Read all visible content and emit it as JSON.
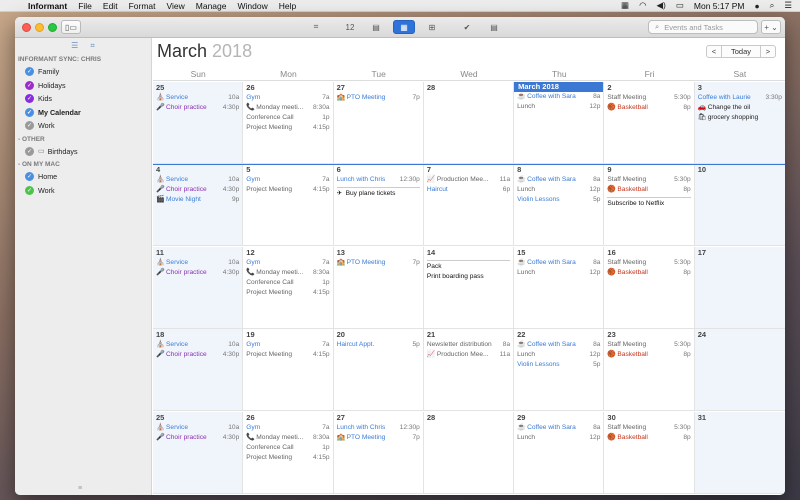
{
  "menubar": {
    "app_name": "Informant",
    "menus": [
      "File",
      "Edit",
      "Format",
      "View",
      "Manage",
      "Window",
      "Help"
    ],
    "clock": "Mon 5:17 PM"
  },
  "toolbar": {
    "day_badge": "12",
    "search_placeholder": "Events and Tasks",
    "add_label": "+ ⌄"
  },
  "sidebar": {
    "sections": [
      {
        "title": "INFORMANT SYNC: CHRIS",
        "items": [
          {
            "label": "Family",
            "color": "#4a90e2",
            "bold": false
          },
          {
            "label": "Holidays",
            "color": "#9b30c8",
            "bold": false
          },
          {
            "label": "Kids",
            "color": "#8a2be2",
            "bold": false
          },
          {
            "label": "My Calendar",
            "color": "#4a90e2",
            "bold": true
          },
          {
            "label": "Work",
            "color": "#9a9a9a",
            "bold": false
          }
        ]
      },
      {
        "title": "- OTHER",
        "items": [
          {
            "label": "Birthdays",
            "color": "#9a9a9a",
            "bold": false
          }
        ]
      },
      {
        "title": "- ON MY MAC",
        "items": [
          {
            "label": "Home",
            "color": "#4a90e2",
            "bold": false
          },
          {
            "label": "Work",
            "color": "#4cc44c",
            "bold": false
          }
        ]
      }
    ]
  },
  "calendar": {
    "month": "March",
    "year": "2018",
    "today_btn": "Today",
    "prev_btn": "<",
    "next_btn": ">",
    "weekdays": [
      "Sun",
      "Mon",
      "Tue",
      "Wed",
      "Thu",
      "Fri",
      "Sat"
    ],
    "weeks": [
      [
        {
          "day": "25",
          "events": [
            {
              "icon": "⛪",
              "title": "Service",
              "time": "10a",
              "color": "blue"
            },
            {
              "icon": "🎤",
              "title": "Choir practice",
              "time": "4:30p",
              "color": "purple"
            }
          ]
        },
        {
          "day": "26",
          "events": [
            {
              "icon": "",
              "title": "Gym",
              "time": "7a",
              "color": "blue"
            },
            {
              "icon": "📞",
              "title": "Monday meeti...",
              "time": "8:30a",
              "color": "gray"
            },
            {
              "icon": "",
              "title": "Conference Call",
              "time": "1p",
              "color": "gray"
            },
            {
              "icon": "",
              "title": "Project Meeting",
              "time": "4:15p",
              "color": "gray"
            }
          ]
        },
        {
          "day": "27",
          "events": [
            {
              "icon": "🏫",
              "title": "PTO Meeting",
              "time": "7p",
              "color": "blue"
            }
          ]
        },
        {
          "day": "28",
          "events": []
        },
        {
          "day": "March 2018",
          "today": true,
          "events": [
            {
              "icon": "☕",
              "title": "Coffee with Sara",
              "time": "8a",
              "color": "blue"
            },
            {
              "icon": "",
              "title": "Lunch",
              "time": "12p",
              "color": "gray"
            }
          ]
        },
        {
          "day": "2",
          "events": [
            {
              "icon": "",
              "title": "Staff Meeting",
              "time": "5:30p",
              "color": "gray"
            },
            {
              "icon": "🏀",
              "title": "Basketball",
              "time": "8p",
              "color": "red"
            }
          ]
        },
        {
          "day": "3",
          "events": [
            {
              "icon": "",
              "title": "Coffee with Laurie",
              "time": "3:30p",
              "color": "blue"
            },
            {
              "icon": "🚗",
              "title": "Change the oil",
              "time": "",
              "color": "black"
            },
            {
              "icon": "🛍",
              "title": "grocery shopping",
              "time": "",
              "color": "black"
            }
          ]
        }
      ],
      [
        {
          "day": "4",
          "events": [
            {
              "icon": "⛪",
              "title": "Service",
              "time": "10a",
              "color": "blue"
            },
            {
              "icon": "🎤",
              "title": "Choir practice",
              "time": "4:30p",
              "color": "purple"
            },
            {
              "icon": "🎬",
              "title": "Movie Night",
              "time": "9p",
              "color": "blue"
            }
          ]
        },
        {
          "day": "5",
          "events": [
            {
              "icon": "",
              "title": "Gym",
              "time": "7a",
              "color": "blue"
            },
            {
              "icon": "",
              "title": "Project Meeting",
              "time": "4:15p",
              "color": "gray"
            }
          ]
        },
        {
          "day": "6",
          "events": [
            {
              "icon": "",
              "title": "Lunch with Chris",
              "time": "12:30p",
              "color": "blue"
            }
          ],
          "tasks": [
            {
              "icon": "✈",
              "title": "Buy plane tickets"
            }
          ]
        },
        {
          "day": "7",
          "events": [
            {
              "icon": "📈",
              "title": "Production Mee...",
              "time": "11a",
              "color": "gray"
            },
            {
              "icon": "",
              "title": "Haircut",
              "time": "6p",
              "color": "blue"
            }
          ]
        },
        {
          "day": "8",
          "events": [
            {
              "icon": "☕",
              "title": "Coffee with Sara",
              "time": "8a",
              "color": "blue"
            },
            {
              "icon": "",
              "title": "Lunch",
              "time": "12p",
              "color": "gray"
            },
            {
              "icon": "",
              "title": "Violin Lessons",
              "time": "5p",
              "color": "blue"
            }
          ]
        },
        {
          "day": "9",
          "events": [
            {
              "icon": "",
              "title": "Staff Meeting",
              "time": "5:30p",
              "color": "gray"
            },
            {
              "icon": "🏀",
              "title": "Basketball",
              "time": "8p",
              "color": "red"
            }
          ],
          "tasks": [
            {
              "icon": "",
              "title": "Subscribe to Netflix"
            }
          ]
        },
        {
          "day": "10",
          "events": []
        }
      ],
      [
        {
          "day": "11",
          "events": [
            {
              "icon": "⛪",
              "title": "Service",
              "time": "10a",
              "color": "blue"
            },
            {
              "icon": "🎤",
              "title": "Choir practice",
              "time": "4:30p",
              "color": "purple"
            }
          ]
        },
        {
          "day": "12",
          "events": [
            {
              "icon": "",
              "title": "Gym",
              "time": "7a",
              "color": "blue"
            },
            {
              "icon": "📞",
              "title": "Monday meeti...",
              "time": "8:30a",
              "color": "gray"
            },
            {
              "icon": "",
              "title": "Conference Call",
              "time": "1p",
              "color": "gray"
            },
            {
              "icon": "",
              "title": "Project Meeting",
              "time": "4:15p",
              "color": "gray"
            }
          ]
        },
        {
          "day": "13",
          "events": [
            {
              "icon": "🏫",
              "title": "PTO Meeting",
              "time": "7p",
              "color": "blue"
            }
          ]
        },
        {
          "day": "14",
          "events": [],
          "tasks": [
            {
              "icon": "",
              "title": "Pack"
            },
            {
              "icon": "",
              "title": "Print boarding pass"
            }
          ]
        },
        {
          "day": "15",
          "events": [
            {
              "icon": "☕",
              "title": "Coffee with Sara",
              "time": "8a",
              "color": "blue"
            },
            {
              "icon": "",
              "title": "Lunch",
              "time": "12p",
              "color": "gray"
            }
          ]
        },
        {
          "day": "16",
          "events": [
            {
              "icon": "",
              "title": "Staff Meeting",
              "time": "5:30p",
              "color": "gray"
            },
            {
              "icon": "🏀",
              "title": "Basketball",
              "time": "8p",
              "color": "red"
            }
          ]
        },
        {
          "day": "17",
          "events": []
        }
      ],
      [
        {
          "day": "18",
          "events": [
            {
              "icon": "⛪",
              "title": "Service",
              "time": "10a",
              "color": "blue"
            },
            {
              "icon": "🎤",
              "title": "Choir practice",
              "time": "4:30p",
              "color": "purple"
            }
          ]
        },
        {
          "day": "19",
          "events": [
            {
              "icon": "",
              "title": "Gym",
              "time": "7a",
              "color": "blue"
            },
            {
              "icon": "",
              "title": "Project Meeting",
              "time": "4:15p",
              "color": "gray"
            }
          ]
        },
        {
          "day": "20",
          "events": [
            {
              "icon": "",
              "title": "Haircut Appt.",
              "time": "5p",
              "color": "blue"
            }
          ]
        },
        {
          "day": "21",
          "events": [
            {
              "icon": "",
              "title": "Newsletter distribution",
              "time": "8a",
              "color": "gray"
            },
            {
              "icon": "📈",
              "title": "Production Mee...",
              "time": "11a",
              "color": "gray"
            }
          ]
        },
        {
          "day": "22",
          "events": [
            {
              "icon": "☕",
              "title": "Coffee with Sara",
              "time": "8a",
              "color": "blue"
            },
            {
              "icon": "",
              "title": "Lunch",
              "time": "12p",
              "color": "gray"
            },
            {
              "icon": "",
              "title": "Violin Lessons",
              "time": "5p",
              "color": "blue"
            }
          ]
        },
        {
          "day": "23",
          "events": [
            {
              "icon": "",
              "title": "Staff Meeting",
              "time": "5:30p",
              "color": "gray"
            },
            {
              "icon": "🏀",
              "title": "Basketball",
              "time": "8p",
              "color": "red"
            }
          ]
        },
        {
          "day": "24",
          "events": []
        }
      ],
      [
        {
          "day": "25",
          "events": [
            {
              "icon": "⛪",
              "title": "Service",
              "time": "10a",
              "color": "blue"
            },
            {
              "icon": "🎤",
              "title": "Choir practice",
              "time": "4:30p",
              "color": "purple"
            }
          ]
        },
        {
          "day": "26",
          "events": [
            {
              "icon": "",
              "title": "Gym",
              "time": "7a",
              "color": "blue"
            },
            {
              "icon": "📞",
              "title": "Monday meeti...",
              "time": "8:30a",
              "color": "gray"
            },
            {
              "icon": "",
              "title": "Conference Call",
              "time": "1p",
              "color": "gray"
            },
            {
              "icon": "",
              "title": "Project Meeting",
              "time": "4:15p",
              "color": "gray"
            }
          ]
        },
        {
          "day": "27",
          "events": [
            {
              "icon": "",
              "title": "Lunch with Chris",
              "time": "12:30p",
              "color": "blue"
            },
            {
              "icon": "🏫",
              "title": "PTO Meeting",
              "time": "7p",
              "color": "blue"
            }
          ]
        },
        {
          "day": "28",
          "events": []
        },
        {
          "day": "29",
          "events": [
            {
              "icon": "☕",
              "title": "Coffee with Sara",
              "time": "8a",
              "color": "blue"
            },
            {
              "icon": "",
              "title": "Lunch",
              "time": "12p",
              "color": "gray"
            }
          ]
        },
        {
          "day": "30",
          "events": [
            {
              "icon": "",
              "title": "Staff Meeting",
              "time": "5:30p",
              "color": "gray"
            },
            {
              "icon": "🏀",
              "title": "Basketball",
              "time": "8p",
              "color": "red"
            }
          ]
        },
        {
          "day": "31",
          "events": []
        }
      ]
    ]
  }
}
